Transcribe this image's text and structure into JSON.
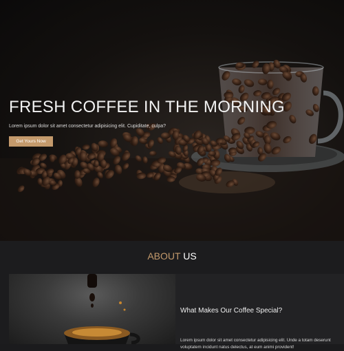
{
  "hero": {
    "title": "FRESH COFFEE IN THE MORNING",
    "subtitle": "Lorem ipsum dolor sit amet consectetur adipisicing elit. Cupiditate, culpa?",
    "cta_label": "Get Yours Now"
  },
  "about": {
    "heading_accent": "ABOUT",
    "heading_rest": "US",
    "card_title": "What Makes Our Coffee Special?",
    "card_text": "Lorem ipsum dolor sit amet consectetur adipisicing elit. Unde a totam deserunt voluptatem incidunt natus delectus, at eum animi provident!"
  },
  "colors": {
    "accent": "#c49a6c",
    "background": "#1c1c1e"
  }
}
